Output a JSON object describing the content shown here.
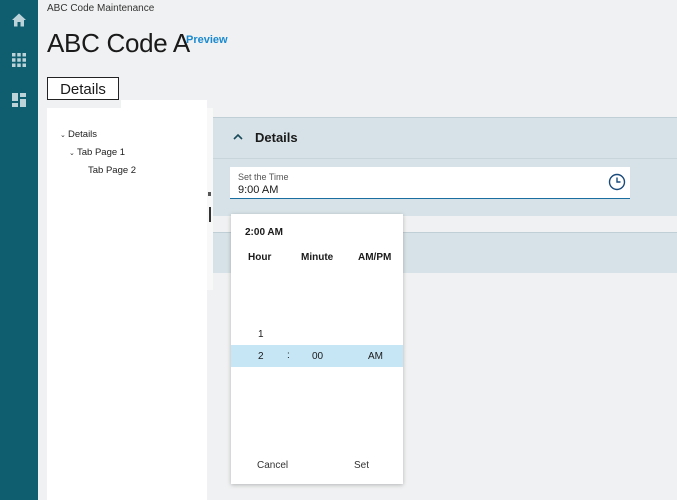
{
  "rail": {
    "icons": [
      "home-icon",
      "apps-grid-icon",
      "dashboard-icon"
    ]
  },
  "header": {
    "breadcrumb": "ABC Code Maintenance",
    "title": "ABC Code A",
    "preview_label": "Preview"
  },
  "tabs": {
    "details_label": "Details"
  },
  "tree": {
    "items": [
      {
        "label": "Details"
      },
      {
        "label": "Tab Page 1"
      },
      {
        "label": "Tab Page 2"
      }
    ]
  },
  "section": {
    "title": "Details"
  },
  "time_field": {
    "label": "Set the Time",
    "value": "9:00 AM"
  },
  "picker": {
    "current": "2:00 AM",
    "col_hour": "Hour",
    "col_minute": "Minute",
    "col_ampm": "AM/PM",
    "hour_above": "1",
    "selected_hour": "2",
    "separator": ":",
    "selected_minute": "00",
    "selected_ampm": "AM",
    "cancel_label": "Cancel",
    "set_label": "Set"
  },
  "colors": {
    "rail": "#0e5e70",
    "accent": "#1a8ad0",
    "section_bg": "#d6e2e7",
    "selection": "#c6e6f6"
  }
}
